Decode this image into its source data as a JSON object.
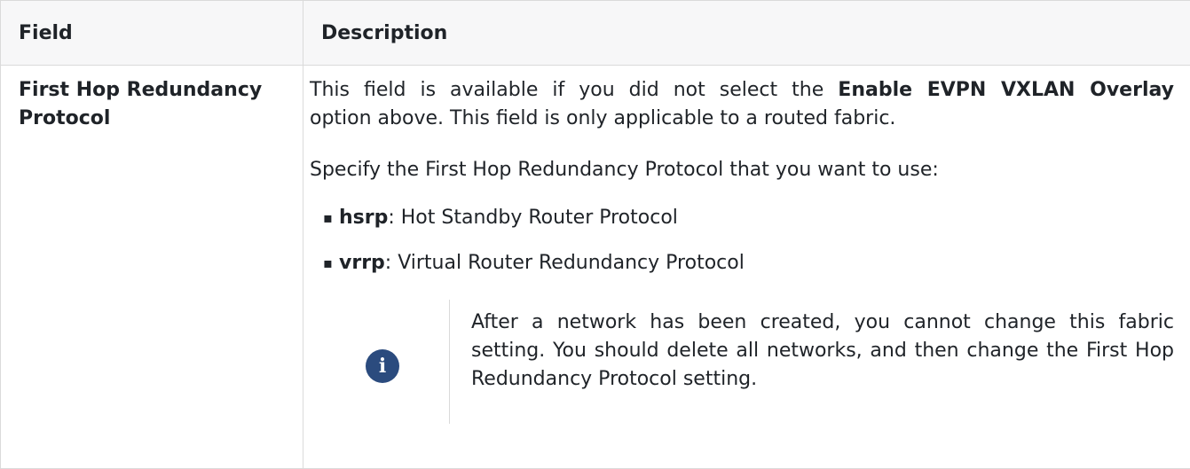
{
  "table": {
    "headers": {
      "field": "Field",
      "description": "Description"
    },
    "row": {
      "field_line1": "First Hop Redundancy",
      "field_line2": "Protocol",
      "desc_p1_before": "This field is available if you did not select the ",
      "desc_p1_bold": "Enable EVPN VXLAN Overlay",
      "desc_p1_after": "option above. This field is only applicable to a routed fabric.",
      "desc_p2": "Specify the First Hop Redundancy Protocol that you want to use:",
      "options": [
        {
          "term": "hsrp",
          "text": ": Hot Standby Router Protocol"
        },
        {
          "term": "vrrp",
          "text": ": Virtual Router Redundancy Protocol"
        }
      ],
      "note_icon": "info-icon",
      "note_icon_glyph": "i",
      "note_text": "After a network has been created, you cannot change this fabric setting. You should delete all networks, and then change the First Hop Redundancy Protocol setting."
    }
  },
  "colors": {
    "icon_bg": "#2b4b7e",
    "header_bg": "#f7f7f8",
    "border": "#dadada"
  }
}
